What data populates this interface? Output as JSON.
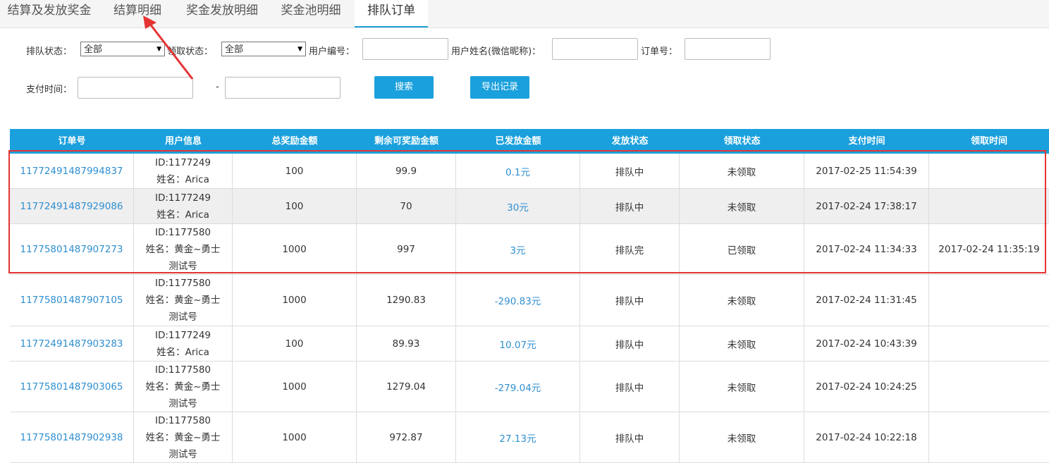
{
  "tabs": [
    "结算及发放奖金",
    "结算明细",
    "奖金发放明细",
    "奖金池明细",
    "排队订单"
  ],
  "filters": {
    "queue_status_label": "排队状态：",
    "queue_status_value": "全部",
    "claim_status_label": "领取状态：",
    "claim_status_value": "全部",
    "user_id_label": "用户编号：",
    "user_name_label": "用户姓名(微信昵称)：",
    "order_no_label": "订单号：",
    "pay_time_label": "支付时间：",
    "range_sep": "-",
    "search_button": "搜索",
    "export_button": "导出记录"
  },
  "table": {
    "headers": [
      "订单号",
      "用户信息",
      "总奖励金额",
      "剩余可奖励金额",
      "已发放金额",
      "发放状态",
      "领取状态",
      "支付时间",
      "领取时间"
    ],
    "rows": [
      {
        "order": "11772491487994837",
        "id": "ID:1177249",
        "name": "姓名：Arica",
        "name2": "",
        "total": "100",
        "remain": "99.9",
        "paid": "0.1元",
        "status": "排队中",
        "claim": "未领取",
        "pay_time": "2017-02-25 11:54:39",
        "claim_time": ""
      },
      {
        "order": "11772491487929086",
        "id": "ID:1177249",
        "name": "姓名：Arica",
        "name2": "",
        "total": "100",
        "remain": "70",
        "paid": "30元",
        "status": "排队中",
        "claim": "未领取",
        "pay_time": "2017-02-24 17:38:17",
        "claim_time": ""
      },
      {
        "order": "11775801487907273",
        "id": "ID:1177580",
        "name": "姓名：黄金~勇士",
        "name2": "测试号",
        "total": "1000",
        "remain": "997",
        "paid": "3元",
        "status": "排队完",
        "claim": "已领取",
        "pay_time": "2017-02-24 11:34:33",
        "claim_time": "2017-02-24 11:35:19"
      },
      {
        "order": "11775801487907105",
        "id": "ID:1177580",
        "name": "姓名：黄金~勇士",
        "name2": "测试号",
        "total": "1000",
        "remain": "1290.83",
        "paid": "-290.83元",
        "status": "排队中",
        "claim": "未领取",
        "pay_time": "2017-02-24 11:31:45",
        "claim_time": ""
      },
      {
        "order": "11772491487903283",
        "id": "ID:1177249",
        "name": "姓名：Arica",
        "name2": "",
        "total": "100",
        "remain": "89.93",
        "paid": "10.07元",
        "status": "排队中",
        "claim": "未领取",
        "pay_time": "2017-02-24 10:43:39",
        "claim_time": ""
      },
      {
        "order": "11775801487903065",
        "id": "ID:1177580",
        "name": "姓名：黄金~勇士",
        "name2": "测试号",
        "total": "1000",
        "remain": "1279.04",
        "paid": "-279.04元",
        "status": "排队中",
        "claim": "未领取",
        "pay_time": "2017-02-24 10:24:25",
        "claim_time": ""
      },
      {
        "order": "11775801487902938",
        "id": "ID:1177580",
        "name": "姓名：黄金~勇士",
        "name2": "测试号",
        "total": "1000",
        "remain": "972.87",
        "paid": "27.13元",
        "status": "排队中",
        "claim": "未领取",
        "pay_time": "2017-02-24 10:22:18",
        "claim_time": ""
      }
    ]
  },
  "colors": {
    "accent": "#1aa0dc",
    "link": "#2f8fd0",
    "annotation": "#e53333"
  }
}
